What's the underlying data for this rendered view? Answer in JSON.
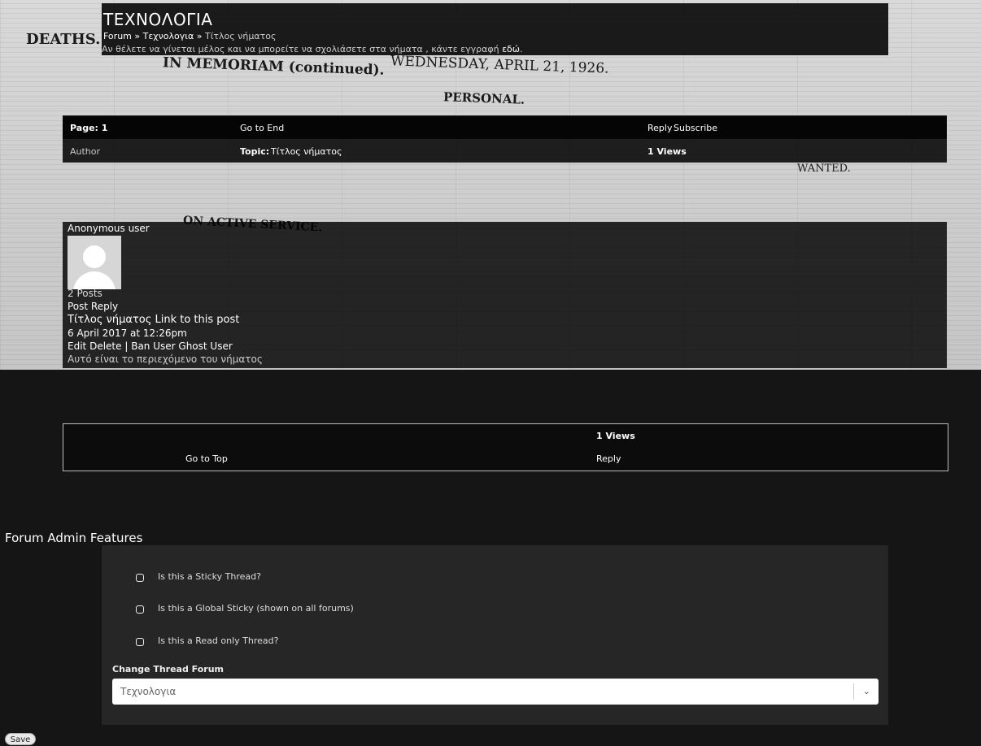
{
  "header": {
    "title": "ΤΕΧΝΟΛΟΓΙΑ",
    "breadcrumb": [
      "Forum",
      "Τεχνολογια",
      "Τίτλος νήματος"
    ],
    "breadcrumb_sep": " » ",
    "notice_prefix": "Αν θέλετε να γίνεται μέλος και να μπορείτε να σχολιάσετε στα νήματα , κάντε εγγραφή ",
    "notice_link": "εδώ",
    "notice_suffix": "."
  },
  "background_text": {
    "deaths": "DEATHS.",
    "memoriam": "IN MEMORIAM (continued).",
    "date": "WEDNESDAY, APRIL 21, 1926.",
    "personal": "PERSONAL.",
    "active_service": "ON ACTIVE SERVICE.",
    "wanted": "WANTED."
  },
  "top_bar": {
    "page": "Page: 1",
    "go_to_end": "Go to End",
    "reply": "Reply",
    "subscribe": "Subscribe"
  },
  "info_bar": {
    "author_label": "Author",
    "topic_label": "Topic:",
    "topic": "Τίτλος νήματος",
    "views": "1 Views"
  },
  "post": {
    "author": "Anonymous user",
    "posts_count": "2 Posts",
    "post_reply": "Post Reply",
    "title": "Τίτλος νήματος",
    "link": "Link to this post",
    "date": "6 April 2017 at 12:26pm",
    "edit": "Edit",
    "delete": "Delete",
    "separator": "|",
    "ban_user": "Ban User",
    "ghost_user": "Ghost User",
    "content": "Αυτό είναι το περιεχόμενο του νήματος"
  },
  "bottom_views": {
    "views": "1 Views"
  },
  "bottom_bar": {
    "go_to_top": "Go to Top",
    "reply": "Reply"
  },
  "admin": {
    "title": "Forum Admin Features",
    "options": [
      "Is this a Sticky Thread?",
      "Is this a Global Sticky (shown on all forums)",
      "Is this a Read only Thread?"
    ],
    "change_forum_label": "Change Thread Forum",
    "selected_forum": "Τεχνολογια",
    "save": "Save"
  }
}
